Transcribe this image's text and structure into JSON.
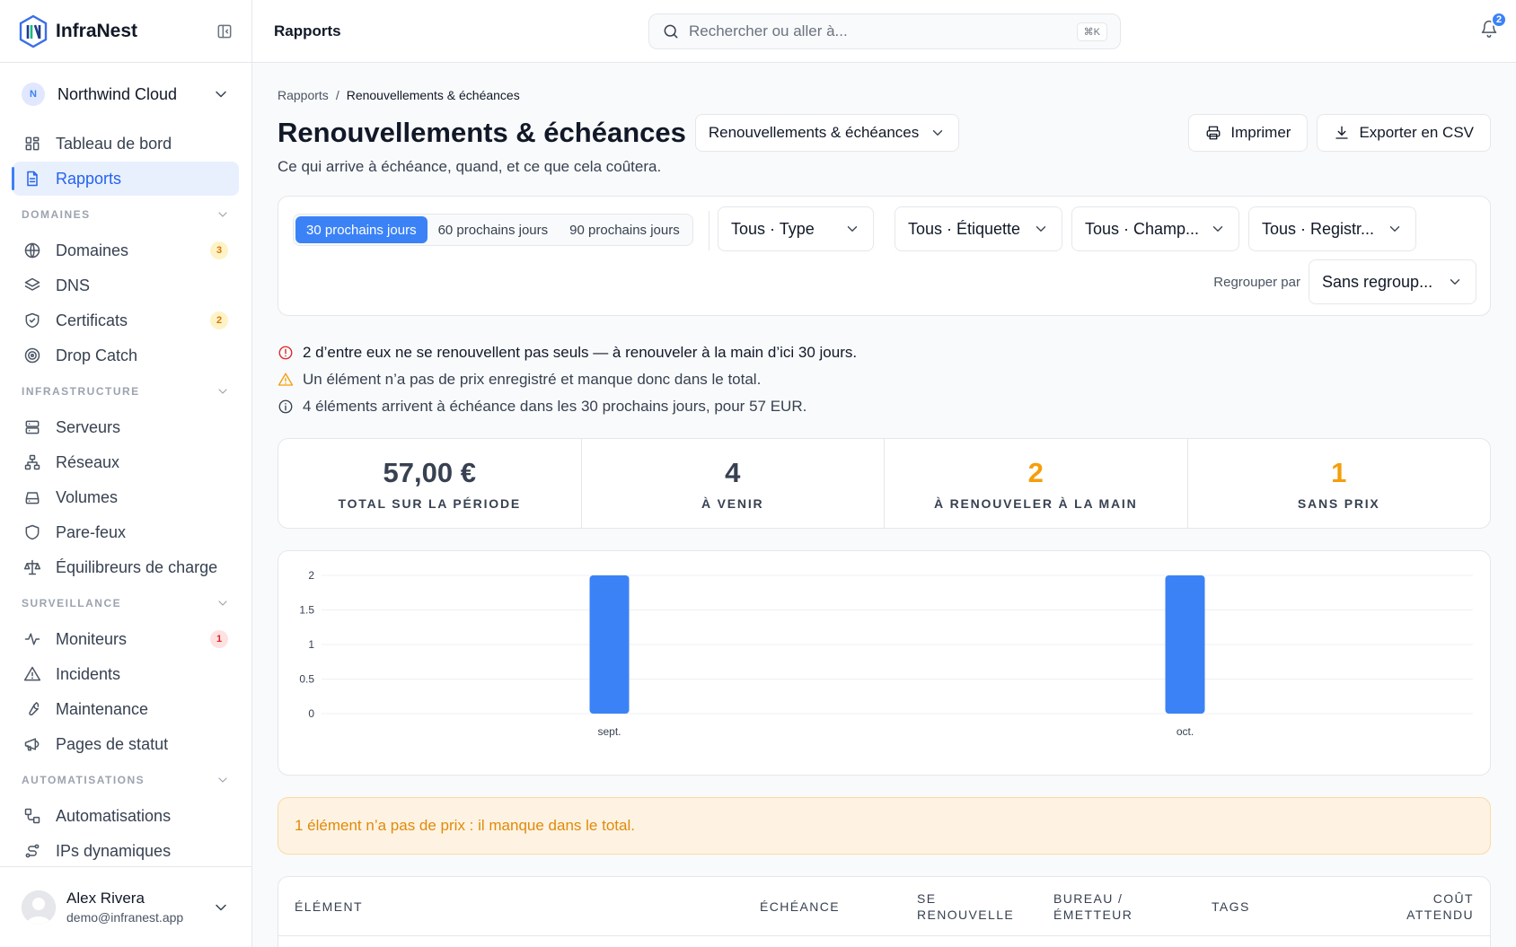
{
  "brand": {
    "name": "InfraNest"
  },
  "org": {
    "initial": "N",
    "name": "Northwind Cloud"
  },
  "nav": {
    "top": [
      {
        "label": "Tableau de bord",
        "icon": "dashboard-icon"
      },
      {
        "label": "Rapports",
        "icon": "document-icon",
        "active": true
      }
    ],
    "sections": [
      {
        "title": "DOMAINES",
        "items": [
          {
            "label": "Domaines",
            "icon": "globe-icon",
            "badge": "3",
            "badge_type": "warn"
          },
          {
            "label": "DNS",
            "icon": "layers-icon"
          },
          {
            "label": "Certificats",
            "icon": "shield-check-icon",
            "badge": "2",
            "badge_type": "warn"
          },
          {
            "label": "Drop Catch",
            "icon": "target-icon"
          }
        ]
      },
      {
        "title": "INFRASTRUCTURE",
        "items": [
          {
            "label": "Serveurs",
            "icon": "server-icon"
          },
          {
            "label": "Réseaux",
            "icon": "network-icon"
          },
          {
            "label": "Volumes",
            "icon": "drive-icon"
          },
          {
            "label": "Pare-feux",
            "icon": "shield-icon"
          },
          {
            "label": "Équilibreurs de charge",
            "icon": "scale-icon"
          }
        ]
      },
      {
        "title": "SURVEILLANCE",
        "items": [
          {
            "label": "Moniteurs",
            "icon": "activity-icon",
            "badge": "1",
            "badge_type": "err"
          },
          {
            "label": "Incidents",
            "icon": "alert-triangle-icon"
          },
          {
            "label": "Maintenance",
            "icon": "wrench-icon"
          },
          {
            "label": "Pages de statut",
            "icon": "megaphone-icon"
          }
        ]
      },
      {
        "title": "AUTOMATISATIONS",
        "items": [
          {
            "label": "Automatisations",
            "icon": "workflow-icon"
          },
          {
            "label": "IPs dynamiques",
            "icon": "route-icon"
          }
        ]
      }
    ]
  },
  "user": {
    "name": "Alex Rivera",
    "email": "demo@infranest.app"
  },
  "topbar": {
    "title": "Rapports",
    "search_placeholder": "Rechercher ou aller à...",
    "shortcut": "⌘K",
    "notif_count": "2"
  },
  "page": {
    "crumb_root": "Rapports",
    "crumb_sep": "/",
    "crumb_current": "Renouvellements & échéances",
    "title": "Renouvellements & échéances",
    "report_select": "Renouvellements & échéances",
    "print_label": "Imprimer",
    "export_label": "Exporter en CSV",
    "subtitle": "Ce qui arrive à échéance, quand, et ce que cela coûtera."
  },
  "filters": {
    "periods": [
      "30 prochains jours",
      "60 prochains jours",
      "90 prochains jours"
    ],
    "type": "Tous · Type",
    "tag": "Tous · Étiquette",
    "field": "Tous · Champ...",
    "registrar": "Tous · Registr...",
    "group_label": "Regrouper par",
    "group_value": "Sans regroup..."
  },
  "alerts": {
    "manual": "2 d’entre eux ne se renouvellent pas seuls — à renouveler à la main d’ici 30 jours.",
    "noprice": "Un élément n’a pas de prix enregistré et manque donc dans le total.",
    "summary": "4 éléments arrivent à échéance dans les 30 prochains jours, pour 57 EUR."
  },
  "stats": [
    {
      "value": "57,00 €",
      "label": "TOTAL SUR LA PÉRIODE"
    },
    {
      "value": "4",
      "label": "À VENIR"
    },
    {
      "value": "2",
      "label": "À RENOUVELER À LA MAIN"
    },
    {
      "value": "1",
      "label": "SANS PRIX"
    }
  ],
  "chart_data": {
    "type": "bar",
    "categories": [
      "sept.",
      "oct."
    ],
    "values": [
      2,
      2
    ],
    "ylim": [
      0,
      2
    ],
    "yticks": [
      "0",
      "0.5",
      "1",
      "1.5",
      "2"
    ],
    "grid": true,
    "color": "#3b82f6"
  },
  "notice": "1 élément n’a pas de prix : il manque dans le total.",
  "table": {
    "headers": [
      "ÉLÉMENT",
      "ÉCHÉANCE",
      "SE\nRENOUVELLE",
      "BUREAU /\nÉMETTEUR",
      "TAGS",
      "COÛT\nATTENDU"
    ]
  }
}
